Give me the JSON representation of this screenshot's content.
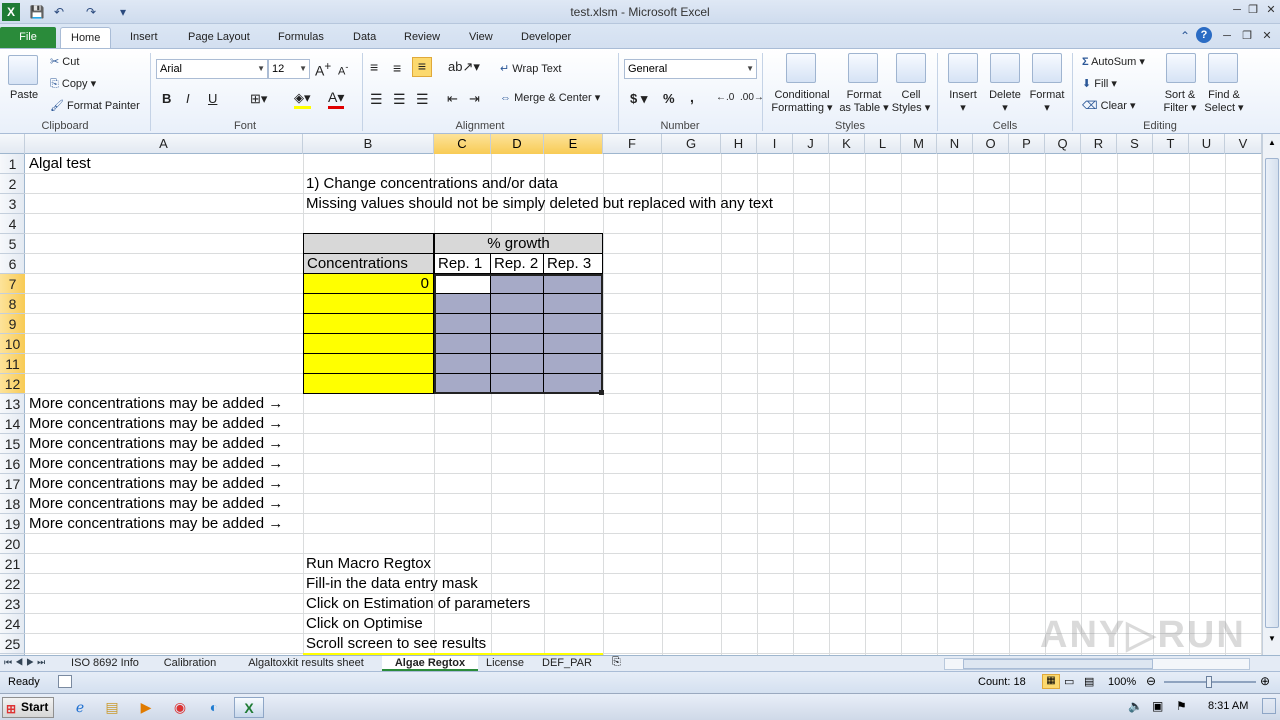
{
  "window": {
    "title": "test.xlsm - Microsoft Excel",
    "min": "─",
    "max": "❐",
    "close": "✕"
  },
  "quick_access": {
    "save": "💾",
    "undo": "↶",
    "redo": "↷",
    "customize": "▾"
  },
  "ribbon_tabs": [
    "File",
    "Home",
    "Insert",
    "Page Layout",
    "Formulas",
    "Data",
    "Review",
    "View",
    "Developer"
  ],
  "clipboard": {
    "paste": "Paste",
    "cut": "Cut",
    "copy": "Copy",
    "format_painter": "Format Painter",
    "label": "Clipboard"
  },
  "font": {
    "name": "Arial",
    "size": "12",
    "bold": "B",
    "italic": "I",
    "underline": "U",
    "label": "Font"
  },
  "alignment": {
    "wrap_text": "Wrap Text",
    "merge_center": "Merge & Center",
    "label": "Alignment"
  },
  "number": {
    "format": "General",
    "currency": "$",
    "percent": "%",
    "comma": ",",
    "label": "Number"
  },
  "styles": {
    "conditional": "Conditional",
    "conditional2": "Formatting",
    "format_table": "Format",
    "format_table2": "as Table",
    "cell_styles": "Cell",
    "cell_styles2": "Styles",
    "label": "Styles"
  },
  "cells": {
    "insert": "Insert",
    "delete": "Delete",
    "format": "Format",
    "label": "Cells"
  },
  "editing": {
    "autosum": "AutoSum",
    "fill": "Fill",
    "clear": "Clear",
    "sort": "Sort &",
    "sort2": "Filter",
    "find": "Find &",
    "find2": "Select",
    "label": "Editing"
  },
  "columns": [
    "A",
    "B",
    "C",
    "D",
    "E",
    "F",
    "G",
    "H",
    "I",
    "J",
    "K",
    "L",
    "M",
    "N",
    "O",
    "P",
    "Q",
    "R",
    "S",
    "T",
    "U",
    "V"
  ],
  "rows": [
    "1",
    "2",
    "3",
    "4",
    "5",
    "6",
    "7",
    "8",
    "9",
    "10",
    "11",
    "12",
    "13",
    "14",
    "15",
    "16",
    "17",
    "18",
    "19",
    "20",
    "21",
    "22",
    "23",
    "24",
    "25"
  ],
  "sheet": {
    "a1": "Algal test",
    "b2": "1) Change concentrations and/or data",
    "b3": "Missing values should not be simply deleted  but replaced with any text",
    "growth_header": "% growth",
    "concentrations_header": "Concentrations",
    "rep1": "Rep. 1",
    "rep2": "Rep. 2",
    "rep3": "Rep. 3",
    "b7": "0",
    "more": [
      "More concentrations may be added →",
      "More concentrations may be added →",
      "More concentrations may be added →",
      "More concentrations may be added →",
      "More concentrations may be added →",
      "More concentrations may be added →",
      "More concentrations may be added →"
    ],
    "steps": [
      "Run Macro Regtox",
      "Fill-in the data entry mask",
      "Click on Estimation of parameters",
      "Click on Optimise",
      "Scroll screen to see results"
    ]
  },
  "sheet_tabs": [
    "ISO 8692 Info",
    "Calibration",
    "Algaltoxkit results sheet",
    "Algae Regtox",
    "License",
    "DEF_PAR"
  ],
  "active_sheet": "Algae Regtox",
  "status": {
    "ready": "Ready",
    "count": "Count: 18",
    "zoom": "100%"
  },
  "taskbar": {
    "start": "Start",
    "time": "8:31 AM"
  },
  "colors": {
    "yellow": "#ffff00",
    "blue_grey": "#a6aac7",
    "header_grey": "#d8d8d8",
    "file_tab": "#2a8b3a"
  },
  "watermark": "ANY▷RUN"
}
